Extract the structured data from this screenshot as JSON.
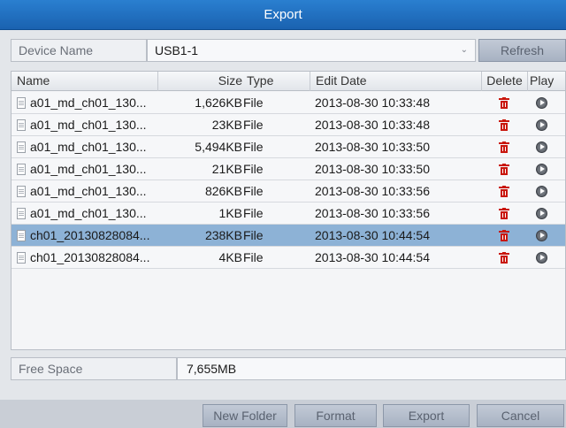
{
  "title": "Export",
  "device": {
    "label": "Device Name",
    "selected": "USB1-1",
    "refresh_label": "Refresh"
  },
  "table": {
    "headers": {
      "name": "Name",
      "size": "Size",
      "type": "Type",
      "edit_date": "Edit Date",
      "delete": "Delete",
      "play": "Play"
    },
    "rows": [
      {
        "name": "a01_md_ch01_130...",
        "size": "1,626KB",
        "type": "File",
        "edit_date": "2013-08-30 10:33:48",
        "selected": false
      },
      {
        "name": "a01_md_ch01_130...",
        "size": "23KB",
        "type": "File",
        "edit_date": "2013-08-30 10:33:48",
        "selected": false
      },
      {
        "name": "a01_md_ch01_130...",
        "size": "5,494KB",
        "type": "File",
        "edit_date": "2013-08-30 10:33:50",
        "selected": false
      },
      {
        "name": "a01_md_ch01_130...",
        "size": "21KB",
        "type": "File",
        "edit_date": "2013-08-30 10:33:50",
        "selected": false
      },
      {
        "name": "a01_md_ch01_130...",
        "size": "826KB",
        "type": "File",
        "edit_date": "2013-08-30 10:33:56",
        "selected": false
      },
      {
        "name": "a01_md_ch01_130...",
        "size": "1KB",
        "type": "File",
        "edit_date": "2013-08-30 10:33:56",
        "selected": false
      },
      {
        "name": "ch01_20130828084...",
        "size": "238KB",
        "type": "File",
        "edit_date": "2013-08-30 10:44:54",
        "selected": true
      },
      {
        "name": "ch01_20130828084...",
        "size": "4KB",
        "type": "File",
        "edit_date": "2013-08-30 10:44:54",
        "selected": false
      }
    ]
  },
  "free_space": {
    "label": "Free Space",
    "value": "7,655MB"
  },
  "footer": {
    "new_folder": "New Folder",
    "format": "Format",
    "export": "Export",
    "cancel": "Cancel"
  },
  "icons": {
    "file": "file-icon",
    "delete": "trash-icon",
    "play": "play-icon",
    "dropdown": "chevron-down-icon"
  },
  "colors": {
    "title_bar": "#1a62b0",
    "selected_row": "#8db2d6",
    "delete_icon": "#c9170d"
  }
}
